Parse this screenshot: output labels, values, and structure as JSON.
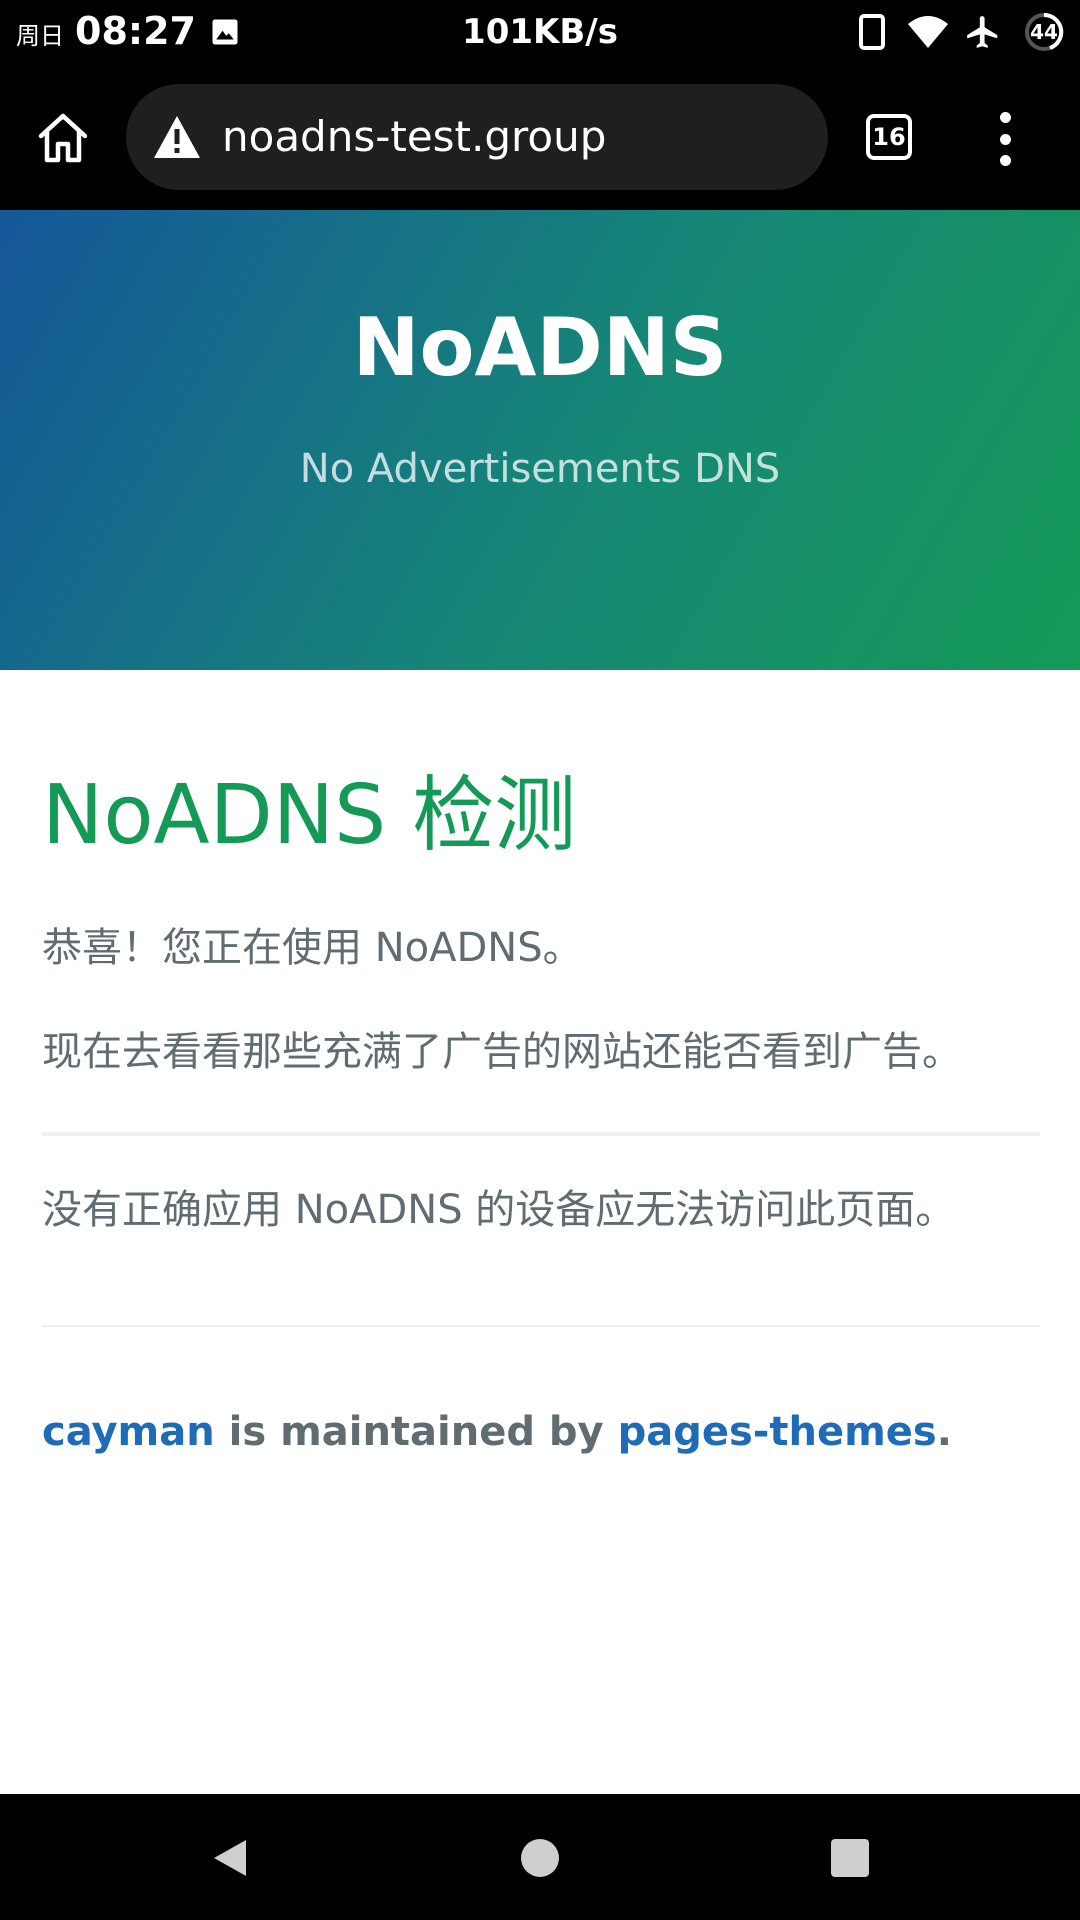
{
  "status_bar": {
    "day": "周日",
    "time": "08:27",
    "net_speed": "101KB/s",
    "battery": "44",
    "icons": [
      "image-icon",
      "vibrate-icon",
      "wifi-icon",
      "airplane-icon",
      "battery-icon"
    ]
  },
  "browser": {
    "url": "noadns-test.group",
    "tab_count": "16",
    "icons": [
      "home-icon",
      "warning-icon",
      "tabs-icon",
      "more-vert-icon"
    ]
  },
  "hero": {
    "title": "NoADNS",
    "subtitle": "No Advertisements DNS",
    "gradient_colors": [
      "#155799",
      "#159957"
    ]
  },
  "content": {
    "heading": "NoADNS 检测",
    "para1": "恭喜！您正在使用 NoADNS。",
    "para2": "现在去看看那些充满了广告的网站还能否看到广告。",
    "para3": "没有正确应用 NoADNS 的设备应无法访问此页面。",
    "heading_color": "#159957",
    "text_color": "#606c71"
  },
  "footer": {
    "theme_link": "cayman",
    "middle": " is maintained by ",
    "author_link": "pages-themes",
    "end": ".",
    "link_color": "#1e6bb8"
  },
  "nav_bar": {
    "icons": [
      "back-icon",
      "home-circle-icon",
      "recents-icon"
    ]
  }
}
